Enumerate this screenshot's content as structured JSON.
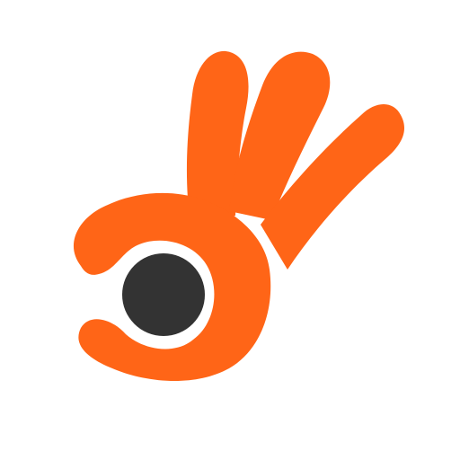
{
  "logo": {
    "icon": "ok-hand-gesture-icon",
    "colors": {
      "hand": "#FF6517",
      "dot": "#333333",
      "background": "#FFFFFF"
    }
  }
}
